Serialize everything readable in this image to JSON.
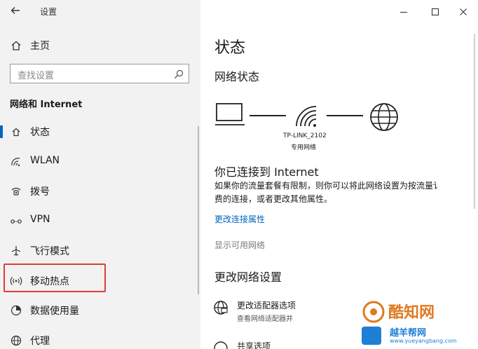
{
  "window": {
    "title": "设置"
  },
  "sidebar": {
    "home_label": "主页",
    "search_placeholder": "查找设置",
    "section_title": "网络和 Internet",
    "items": [
      {
        "label": "状态",
        "icon": "home-status-icon"
      },
      {
        "label": "WLAN",
        "icon": "wifi-icon"
      },
      {
        "label": "拨号",
        "icon": "dialup-icon"
      },
      {
        "label": "VPN",
        "icon": "vpn-icon"
      },
      {
        "label": "飞行模式",
        "icon": "airplane-icon"
      },
      {
        "label": "移动热点",
        "icon": "hotspot-icon"
      },
      {
        "label": "数据使用量",
        "icon": "data-usage-icon"
      },
      {
        "label": "代理",
        "icon": "globe-icon"
      }
    ],
    "highlight_color": "#e23b3b"
  },
  "main": {
    "page_title": "状态",
    "network_status_heading": "网络状态",
    "network_name": "TP-LINK_2102",
    "network_type": "专用网络",
    "connected_title": "你已连接到 Internet",
    "connected_desc_line1": "如果你的流量套餐有限制，则你可以将此网络设置为按流量讠",
    "connected_desc_line2": "费的连接，或者更改其他属性。",
    "change_props_link": "更改连接属性",
    "show_networks_link": "显示可用网络",
    "change_settings_heading": "更改网络设置",
    "adapter_title": "更改适配器选项",
    "adapter_desc": "查看网络适配器并",
    "sharing_title": "共享选项"
  },
  "watermark": {
    "brand": "酷知网",
    "site": "www.yueyangbang.com",
    "sub": "越羊帮网"
  },
  "colors": {
    "accent": "#0067c0",
    "sidebar_bg": "#f2f2f2",
    "main_bg": "#ffffff",
    "watermark": "#e07a1f"
  }
}
